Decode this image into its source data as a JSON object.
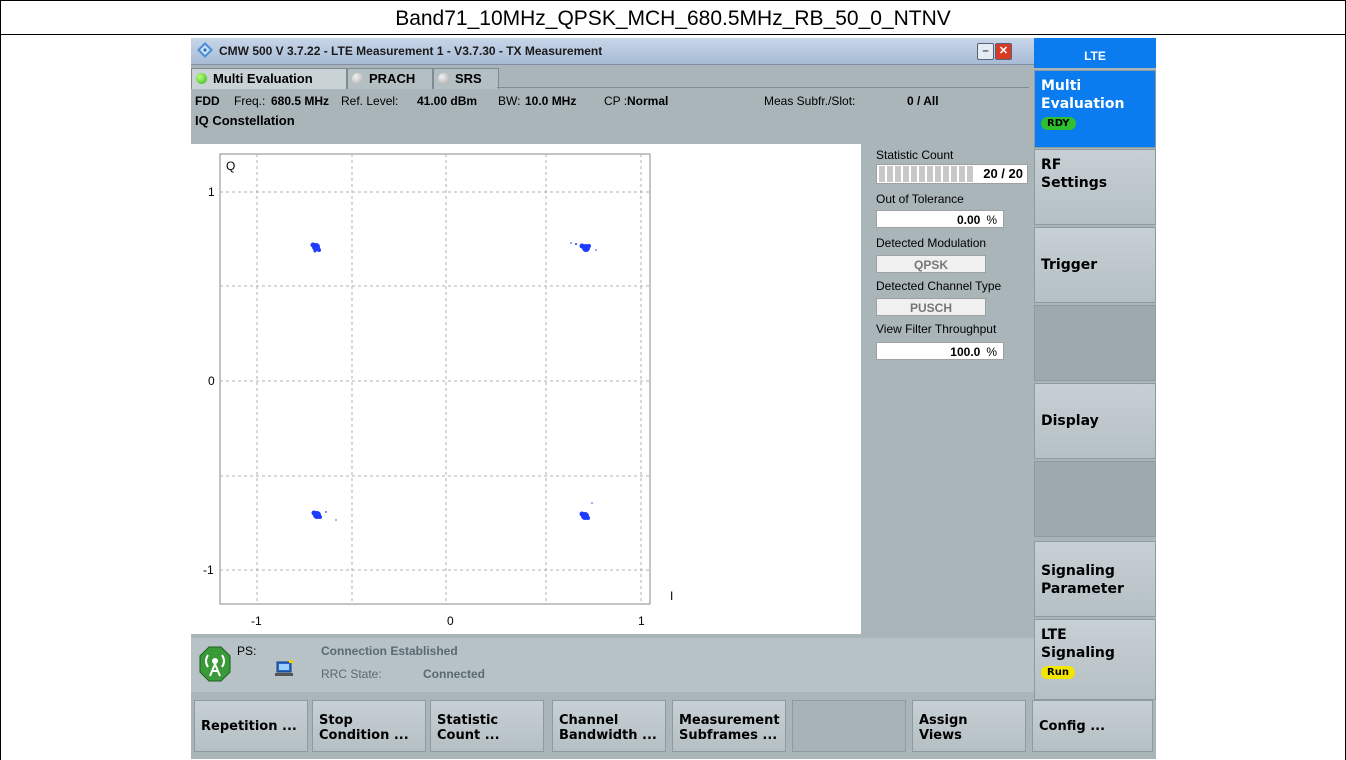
{
  "page_title": "Band71_10MHz_QPSK_MCH_680.5MHz_RB_50_0_NTNV",
  "window": {
    "title": "CMW 500 V 3.7.22 - LTE Measurement 1 - V3.7.30 - TX Measurement",
    "app_icon": "rs-diamond-icon",
    "minimize_icon": "minimize-icon",
    "close_icon": "close-icon"
  },
  "tabs": [
    {
      "label": "Multi Evaluation",
      "active": true
    },
    {
      "label": "PRACH",
      "active": false
    },
    {
      "label": "SRS",
      "active": false
    }
  ],
  "info": {
    "duplex": "FDD",
    "freq_label": "Freq.:",
    "freq_value": "680.5 MHz",
    "ref_label": "Ref. Level:",
    "ref_value": "41.00 dBm",
    "bw_label": "BW:",
    "bw_value": "10.0 MHz",
    "cp_label": "CP :",
    "cp_value": "Normal",
    "meas_label": "Meas Subfr./Slot:",
    "meas_value": "0  / All"
  },
  "iq_title": "IQ Constellation",
  "plot": {
    "q_label": "Q",
    "i_label": "I",
    "y_ticks": [
      "1",
      "0",
      "-1"
    ],
    "x_ticks": [
      "-1",
      "0",
      "1"
    ]
  },
  "side_panel": {
    "statistic_count_label": "Statistic Count",
    "statistic_count_value": "20 / 20",
    "out_of_tolerance_label": "Out of Tolerance",
    "out_of_tolerance_value": "0.00",
    "percent_unit": "%",
    "detected_modulation_label": "Detected Modulation",
    "detected_modulation_value": "QPSK",
    "detected_channel_label": "Detected Channel Type",
    "detected_channel_value": "PUSCH",
    "view_filter_label": "View Filter Throughput",
    "view_filter_value": "100.0"
  },
  "status": {
    "ps_label": "PS:",
    "connection": "Connection Established",
    "rrc_label": "RRC State:",
    "rrc_value": "Connected",
    "antenna_icon": "antenna-icon",
    "device_icon": "device-icon"
  },
  "right_panel": {
    "header": "LTE",
    "keys": [
      {
        "label": "Multi\nEvaluation",
        "badge": "RDY"
      },
      {
        "label": "RF\nSettings"
      },
      {
        "label": "Trigger"
      },
      {
        "label": ""
      },
      {
        "label": "Display"
      },
      {
        "label": ""
      },
      {
        "label": "Signaling\nParameter"
      },
      {
        "label": "LTE\nSignaling",
        "badge": "Run"
      }
    ]
  },
  "softkeys": [
    "Repetition ...",
    "Stop\nCondition ...",
    "Statistic\nCount ...",
    "Channel\nBandwidth ...",
    "Measurement\nSubframes ...",
    "",
    "Assign\nViews",
    "Config ..."
  ],
  "colors": {
    "accent": "#0a7cf0",
    "constellation_points": "#1e3cff",
    "ready_badge": "#2ec02e",
    "run_badge": "#f2e600"
  }
}
